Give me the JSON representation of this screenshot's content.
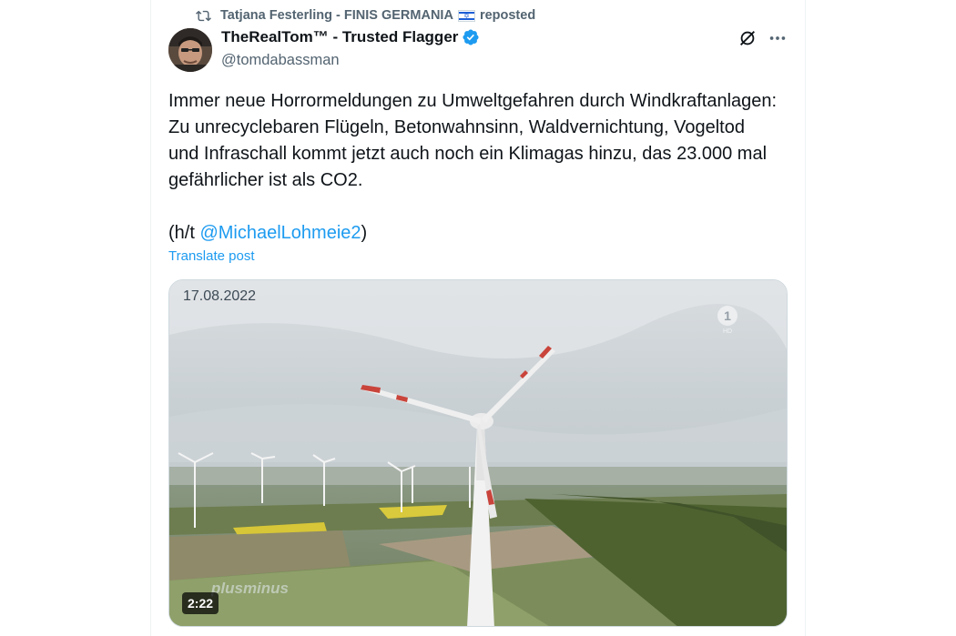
{
  "repost": {
    "icon": "repost-icon",
    "by": "Tatjana Festerling - FINIS GERMANIA",
    "flag": "israel-flag-emoji",
    "suffix": "reposted"
  },
  "author": {
    "name": "TheRealTom™ - Trusted Flagger",
    "handle": "@tomdabassman",
    "verified": true,
    "badge_color": "#1d9bf0"
  },
  "actions": {
    "grok_icon": "grok-icon",
    "more_icon": "more-icon"
  },
  "tweet": {
    "text": "Immer neue Horrormeldungen zu Umweltgefahren durch Windkraftanlagen: Zu unrecyclebaren Flügeln, Betonwahnsinn, Waldvernichtung, Vogeltod und Infraschall kommt jetzt auch noch ein Klimagas hinzu, das 23.000 mal gefährlicher ist als CO2.",
    "ht_prefix": "(h/t ",
    "mention": "@MichaelLohmeie2",
    "ht_suffix": ")",
    "translate_label": "Translate post"
  },
  "video": {
    "date": "17.08.2022",
    "duration": "2:22",
    "watermark": "plusminus",
    "channel_logo": "ard-1-logo",
    "channel_label": "HD"
  },
  "colors": {
    "link": "#1d9bf0",
    "secondary_text": "#536471"
  }
}
